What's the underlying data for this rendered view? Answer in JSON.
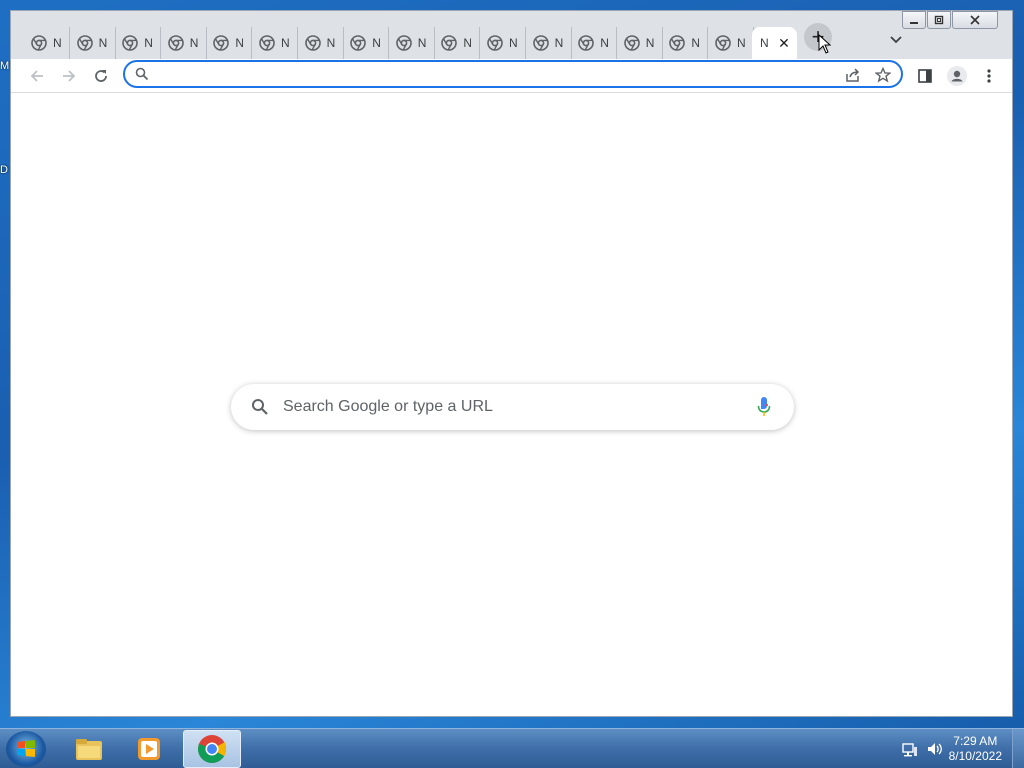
{
  "desktop": {
    "left_labels": [
      "M",
      "D"
    ]
  },
  "browser": {
    "tabs": [
      {
        "title": "N"
      },
      {
        "title": "N"
      },
      {
        "title": "N"
      },
      {
        "title": "N"
      },
      {
        "title": "N"
      },
      {
        "title": "N"
      },
      {
        "title": "N"
      },
      {
        "title": "N"
      },
      {
        "title": "N"
      },
      {
        "title": "N"
      },
      {
        "title": "N"
      },
      {
        "title": "N"
      },
      {
        "title": "N"
      },
      {
        "title": "N"
      },
      {
        "title": "N"
      },
      {
        "title": "N"
      }
    ],
    "active_tab": {
      "title": "N",
      "close_icon": "close-icon"
    },
    "new_tab_label": "+",
    "omnibox": {
      "value": "",
      "placeholder": ""
    },
    "ntp": {
      "search_placeholder": "Search Google or type a URL"
    },
    "colors": {
      "accent": "#1a73e8",
      "tab_strip": "#dee1e6"
    }
  },
  "taskbar": {
    "items": [
      "windows-explorer",
      "media-player",
      "chrome"
    ],
    "active_item": "chrome",
    "clock": {
      "time": "7:29 AM",
      "date": "8/10/2022"
    }
  }
}
